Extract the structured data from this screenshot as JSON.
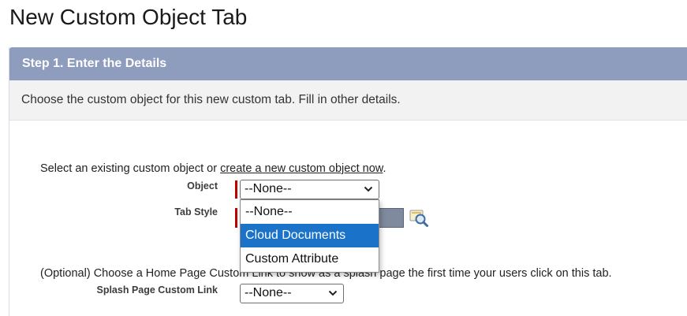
{
  "page": {
    "title": "New Custom Object Tab"
  },
  "step": {
    "header": "Step 1. Enter the Details",
    "description": "Choose the custom object for this new custom tab. Fill in other details."
  },
  "intro": {
    "text": "Select an existing custom object or ",
    "link": "create a new custom object now",
    "suffix": "."
  },
  "fields": {
    "object": {
      "label": "Object",
      "value": "--None--",
      "required": true
    },
    "tab_style": {
      "label": "Tab Style",
      "required": true,
      "swatch_color": "#7f8a9f"
    },
    "splash": {
      "label": "Splash Page Custom Link",
      "value": "--None--"
    }
  },
  "dropdown": {
    "options": [
      {
        "label": "--None--",
        "selected": false
      },
      {
        "label": "Cloud Documents",
        "selected": true
      },
      {
        "label": "Custom Attribute",
        "selected": false
      }
    ]
  },
  "optional": {
    "text": "(Optional) Choose a Home Page Custom Link to show as a splash page the first time your users click on this tab."
  },
  "colors": {
    "header_bg": "#8e9dbe",
    "required": "#c00000",
    "selected_option": "#1a73c9"
  },
  "icons": {
    "object_select": "chevron-down-icon",
    "splash_select": "chevron-down-icon",
    "lookup": "lookup-magnifier-icon"
  }
}
